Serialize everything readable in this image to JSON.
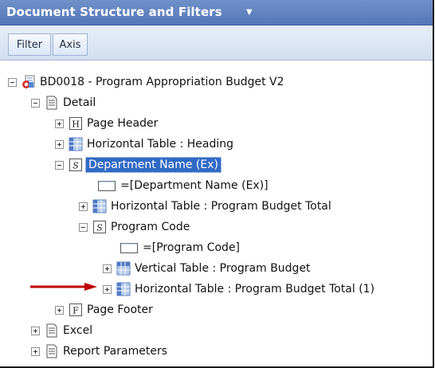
{
  "panel": {
    "title": "Document Structure and Filters",
    "title_caret": "▼"
  },
  "tabs": {
    "filter": "Filter",
    "axis": "Axis"
  },
  "tree": {
    "root": "BD0018 - Program Appropriation Budget V2",
    "detail": "Detail",
    "page_header": "Page Header",
    "horizontal_heading": "Horizontal Table : Heading",
    "department_section": "Department Name (Ex)",
    "department_field": "=[Department Name (Ex)]",
    "horizontal_program_budget_total": "Horizontal Table : Program Budget Total",
    "program_code_section": "Program Code",
    "program_code_field": "=[Program Code]",
    "vertical_program_budget": "Vertical Table : Program Budget",
    "horizontal_program_budget_total_1": "Horizontal Table : Program Budget Total (1)",
    "page_footer": "Page Footer",
    "excel": "Excel",
    "report_parameters": "Report Parameters"
  },
  "icons": {
    "report": "report-icon",
    "document": "document-icon",
    "page_header": "page-header-icon",
    "table": "table-icon",
    "section": "section-icon",
    "cell": "cell-icon",
    "page_footer": "page-footer-icon",
    "annotation_arrow": "red-arrow-icon"
  },
  "colors": {
    "title_bar": "#5f80be",
    "selection": "#316ac5",
    "annotation_arrow": "#c00000"
  }
}
